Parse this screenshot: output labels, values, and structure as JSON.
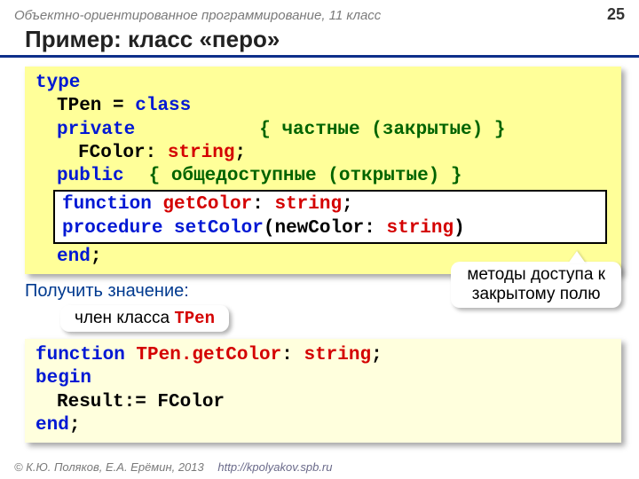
{
  "header": {
    "course": "Объектно-ориентированное программирование, 11 класс",
    "page": "25"
  },
  "title": "Пример: класс «перо»",
  "code1": {
    "l1_kw": "type",
    "l2_name": "TPen",
    "l2_eq": " = ",
    "l2_class": "class",
    "l3_priv": "private",
    "l3_comment": "{ частные (закрытые) }",
    "l4_field": "FColor: ",
    "l4_type": "string",
    "l4_semicolon": ";",
    "l5_pub": "public",
    "l5_comment": "{ общедоступные (открытые) }",
    "inner_l1_fn": "function ",
    "inner_l1_name": "getColor",
    "inner_l1_colon": ": ",
    "inner_l1_type": "string",
    "inner_l1_semicolon": ";",
    "inner_l2_proc": "procedure ",
    "inner_l2_name": "setColor",
    "inner_l2_open": "(newColor: ",
    "inner_l2_type": "string",
    "inner_l2_close": ")",
    "l8_end": "end",
    "l8_semi": ";"
  },
  "mid": {
    "obtain": "Получить значение:",
    "badge_text": "член класса ",
    "badge_class": "TPen",
    "callout_l1": "методы доступа к",
    "callout_l2": "закрытому полю"
  },
  "code2": {
    "l1_fn": "function ",
    "l1_class": "TPen.getColor",
    "l1_colon": ": ",
    "l1_type": "string",
    "l1_semi": ";",
    "l2": "begin",
    "l3": "Result:= FColor",
    "l4": "end",
    "l4_semi": ";"
  },
  "footer": {
    "copyright": "© К.Ю. Поляков, Е.А. Ерёмин, 2013",
    "url": "http://kpolyakov.spb.ru"
  }
}
